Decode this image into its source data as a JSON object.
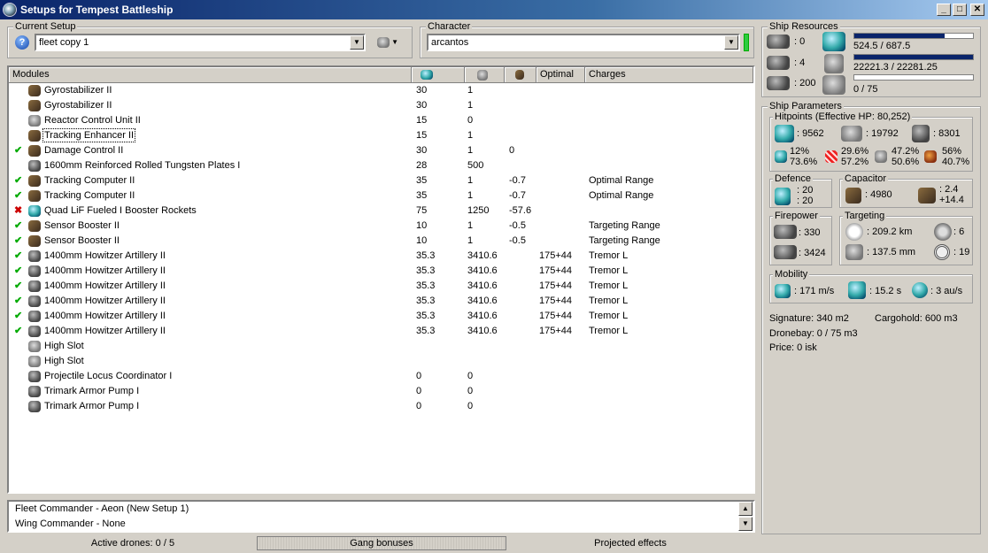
{
  "window": {
    "title": "Setups for Tempest Battleship",
    "min": "_",
    "max": "□",
    "close": "✕"
  },
  "setup": {
    "label": "Current Setup",
    "value": "fleet copy 1"
  },
  "character": {
    "label": "Character",
    "value": "arcantos"
  },
  "modules": {
    "headers": [
      "Modules",
      "",
      "",
      "",
      "Optimal",
      "Charges"
    ],
    "header_icons": [
      "cpu-icon",
      "powergrid-icon",
      "capacitor-icon"
    ],
    "rows": [
      {
        "state": "",
        "icon": "gyrostabilizer-icon",
        "name": "Gyrostabilizer II",
        "cpu": "30",
        "pg": "1",
        "cap": "",
        "opt": "",
        "charge": ""
      },
      {
        "state": "",
        "icon": "gyrostabilizer-icon",
        "name": "Gyrostabilizer II",
        "cpu": "30",
        "pg": "1",
        "cap": "",
        "opt": "",
        "charge": ""
      },
      {
        "state": "",
        "icon": "reactor-icon",
        "name": "Reactor Control Unit II",
        "cpu": "15",
        "pg": "0",
        "cap": "",
        "opt": "",
        "charge": ""
      },
      {
        "state": "",
        "icon": "tracking-enhancer-icon",
        "name": "Tracking Enhancer II",
        "cpu": "15",
        "pg": "1",
        "cap": "",
        "opt": "",
        "charge": "",
        "focused": true
      },
      {
        "state": "on",
        "icon": "damage-control-icon",
        "name": "Damage Control II",
        "cpu": "30",
        "pg": "1",
        "cap": "0",
        "opt": "",
        "charge": ""
      },
      {
        "state": "",
        "icon": "armor-plate-icon",
        "name": "1600mm Reinforced Rolled Tungsten Plates I",
        "cpu": "28",
        "pg": "500",
        "cap": "",
        "opt": "",
        "charge": ""
      },
      {
        "state": "on",
        "icon": "tracking-computer-icon",
        "name": "Tracking Computer II",
        "cpu": "35",
        "pg": "1",
        "cap": "-0.7",
        "opt": "",
        "charge": "Optimal Range"
      },
      {
        "state": "on",
        "icon": "tracking-computer-icon",
        "name": "Tracking Computer II",
        "cpu": "35",
        "pg": "1",
        "cap": "-0.7",
        "opt": "",
        "charge": "Optimal Range"
      },
      {
        "state": "off",
        "icon": "afterburner-icon",
        "name": "Quad LiF Fueled I Booster Rockets",
        "cpu": "75",
        "pg": "1250",
        "cap": "-57.6",
        "opt": "",
        "charge": ""
      },
      {
        "state": "on",
        "icon": "sensor-booster-icon",
        "name": "Sensor Booster II",
        "cpu": "10",
        "pg": "1",
        "cap": "-0.5",
        "opt": "",
        "charge": "Targeting Range"
      },
      {
        "state": "on",
        "icon": "sensor-booster-icon",
        "name": "Sensor Booster II",
        "cpu": "10",
        "pg": "1",
        "cap": "-0.5",
        "opt": "",
        "charge": "Targeting Range"
      },
      {
        "state": "on",
        "icon": "artillery-icon",
        "name": "1400mm Howitzer Artillery II",
        "cpu": "35.3",
        "pg": "3410.6",
        "cap": "",
        "opt": "175+44",
        "charge": "Tremor L"
      },
      {
        "state": "on",
        "icon": "artillery-icon",
        "name": "1400mm Howitzer Artillery II",
        "cpu": "35.3",
        "pg": "3410.6",
        "cap": "",
        "opt": "175+44",
        "charge": "Tremor L"
      },
      {
        "state": "on",
        "icon": "artillery-icon",
        "name": "1400mm Howitzer Artillery II",
        "cpu": "35.3",
        "pg": "3410.6",
        "cap": "",
        "opt": "175+44",
        "charge": "Tremor L"
      },
      {
        "state": "on",
        "icon": "artillery-icon",
        "name": "1400mm Howitzer Artillery II",
        "cpu": "35.3",
        "pg": "3410.6",
        "cap": "",
        "opt": "175+44",
        "charge": "Tremor L"
      },
      {
        "state": "on",
        "icon": "artillery-icon",
        "name": "1400mm Howitzer Artillery II",
        "cpu": "35.3",
        "pg": "3410.6",
        "cap": "",
        "opt": "175+44",
        "charge": "Tremor L"
      },
      {
        "state": "on",
        "icon": "artillery-icon",
        "name": "1400mm Howitzer Artillery II",
        "cpu": "35.3",
        "pg": "3410.6",
        "cap": "",
        "opt": "175+44",
        "charge": "Tremor L"
      },
      {
        "state": "",
        "icon": "high-slot-icon",
        "name": "High Slot",
        "cpu": "",
        "pg": "",
        "cap": "",
        "opt": "",
        "charge": ""
      },
      {
        "state": "",
        "icon": "high-slot-icon",
        "name": "High Slot",
        "cpu": "",
        "pg": "",
        "cap": "",
        "opt": "",
        "charge": ""
      },
      {
        "state": "",
        "icon": "rig-icon",
        "name": "Projectile Locus Coordinator I",
        "cpu": "0",
        "pg": "0",
        "cap": "",
        "opt": "",
        "charge": ""
      },
      {
        "state": "",
        "icon": "rig-icon",
        "name": "Trimark Armor Pump I",
        "cpu": "0",
        "pg": "0",
        "cap": "",
        "opt": "",
        "charge": ""
      },
      {
        "state": "",
        "icon": "rig-icon",
        "name": "Trimark Armor Pump I",
        "cpu": "0",
        "pg": "0",
        "cap": "",
        "opt": "",
        "charge": ""
      }
    ]
  },
  "gang": {
    "line1": "Fleet Commander - Aeon (New Setup 1)",
    "line2": "Wing Commander - None"
  },
  "status": {
    "drones": "Active drones: 0 / 5",
    "gang": "Gang bonuses",
    "projected": "Projected effects"
  },
  "resources": {
    "label": "Ship Resources",
    "turret": ": 0",
    "launcher": ": 4",
    "drones": ": 200",
    "cpu": "524.5 / 687.5",
    "cpu_fill": 0.763,
    "pg": "22221.3 / 22281.25",
    "pg_fill": 0.997,
    "drone_bw": "0 / 75",
    "drone_fill": 0
  },
  "params": {
    "label": "Ship Parameters",
    "hp": {
      "label": "Hitpoints (Effective HP: 80,252)",
      "shield": ": 9562",
      "armor": ": 19792",
      "structure": ": 8301",
      "res": [
        [
          "12%",
          "73.6%"
        ],
        [
          "29.6%",
          "57.2%"
        ],
        [
          "47.2%",
          "50.6%"
        ],
        [
          "56%",
          "40.7%"
        ]
      ]
    },
    "defence": {
      "label": "Defence",
      "a": ": 20",
      "b": ": 20"
    },
    "capacitor": {
      "label": "Capacitor",
      "cap": ": 4980",
      "rate1": ": 2.4",
      "rate2": "+14.4"
    },
    "firepower": {
      "label": "Firepower",
      "a": ": 330",
      "b": ": 3424"
    },
    "targeting": {
      "label": "Targeting",
      "range": ": 209.2 km",
      "targets": ": 6",
      "sig": ": 137.5 mm",
      "scan": ": 19"
    },
    "mobility": {
      "label": "Mobility",
      "speed": ": 171 m/s",
      "align": ": 15.2 s",
      "warp": ": 3 au/s"
    },
    "signature": "Signature: 340 m2",
    "cargo": "Cargohold: 600 m3",
    "dronebay": "Dronebay: 0 / 75 m3",
    "price": "Price: 0 isk"
  }
}
